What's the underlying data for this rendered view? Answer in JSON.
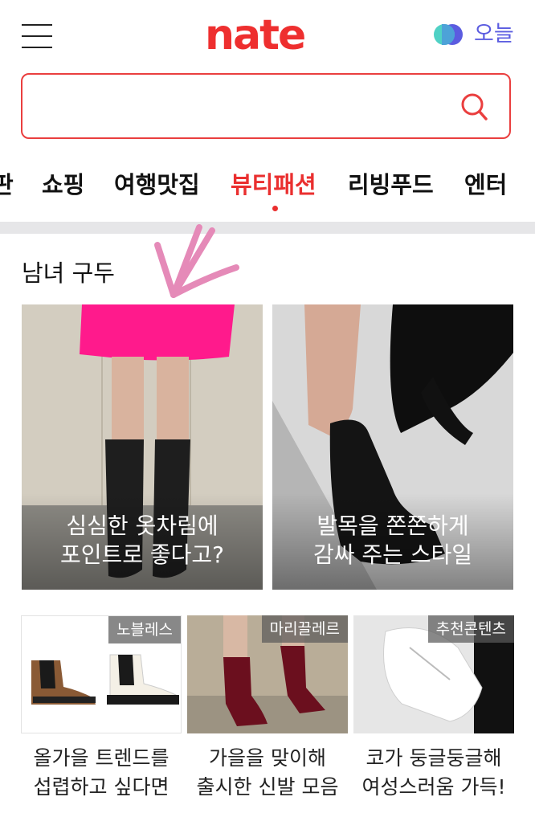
{
  "header": {
    "logo": "nate",
    "today_label": "오늘",
    "menu_icon": "hamburger-menu-icon",
    "mode_icon": "theme-toggle-icon"
  },
  "search": {
    "placeholder": "",
    "value": "",
    "icon": "search-icon"
  },
  "tabs": [
    {
      "label": "판",
      "active": false
    },
    {
      "label": "쇼핑",
      "active": false
    },
    {
      "label": "여행맛집",
      "active": false
    },
    {
      "label": "뷰티패션",
      "active": true
    },
    {
      "label": "리빙푸드",
      "active": false
    },
    {
      "label": "엔터",
      "active": false
    }
  ],
  "section": {
    "title": "남녀 구두"
  },
  "featured": [
    {
      "caption_line1": "심심한 옷차림에",
      "caption_line2": "포인트로 좋다고?"
    },
    {
      "caption_line1": "발목을 쫀쫀하게",
      "caption_line2": "감싸 주는 스타일"
    }
  ],
  "items": [
    {
      "badge": "노블레스",
      "caption_line1": "올가을 트렌드를",
      "caption_line2": "섭렵하고 싶다면"
    },
    {
      "badge": "마리끌레르",
      "caption_line1": "가을을 맞이해",
      "caption_line2": "출시한 신발 모음"
    },
    {
      "badge": "추천콘텐츠",
      "caption_line1": "코가 둥글둥글해",
      "caption_line2": "여성스러움 가득!"
    }
  ],
  "colors": {
    "brand": "#ee2f2f",
    "accent_blue": "#5b5ce0",
    "accent_teal": "#4fd1c5",
    "divider": "#e6e6e8"
  }
}
